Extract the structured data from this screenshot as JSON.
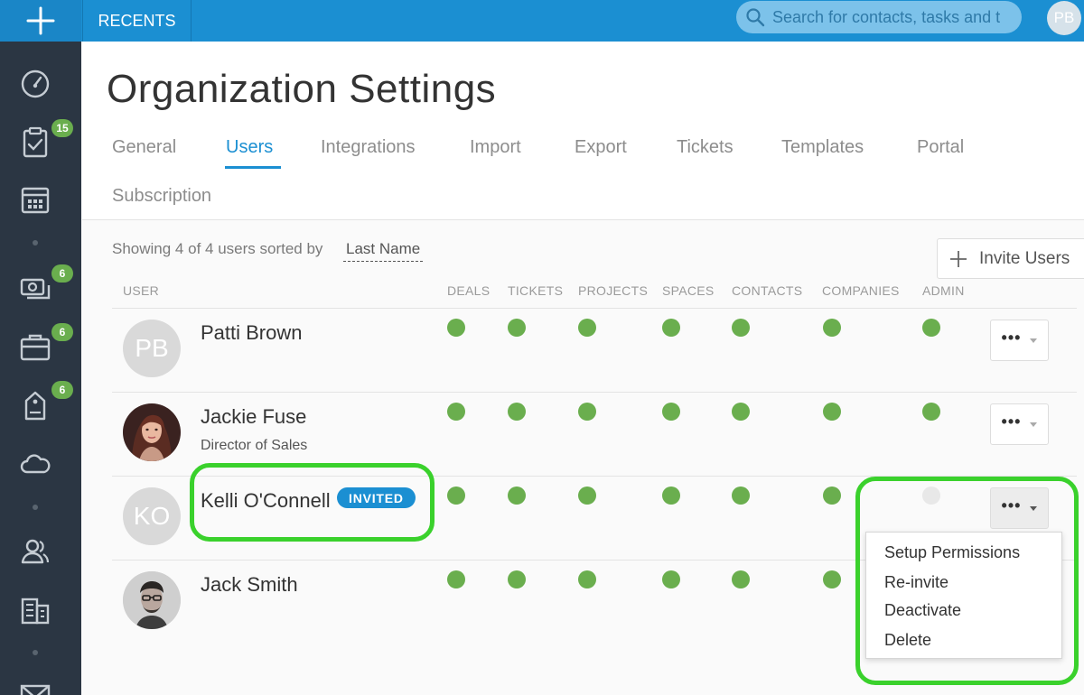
{
  "topbar": {
    "recents_label": "RECENTS",
    "search_placeholder": "Search for contacts, tasks and t",
    "user_initials": "PB"
  },
  "sidebar": {
    "items": [
      {
        "icon": "dashboard-icon"
      },
      {
        "icon": "tasks-clipboard-icon",
        "badge": "15"
      },
      {
        "icon": "calendar-icon"
      },
      {
        "icon": "money-icon",
        "badge": "6"
      },
      {
        "icon": "briefcase-icon",
        "badge": "6"
      },
      {
        "icon": "ticket-icon",
        "badge": "6"
      },
      {
        "icon": "cloud-icon"
      },
      {
        "icon": "contacts-icon"
      },
      {
        "icon": "companies-icon"
      },
      {
        "icon": "email-icon"
      }
    ]
  },
  "page": {
    "title": "Organization Settings",
    "tabs": [
      {
        "label": "General"
      },
      {
        "label": "Users",
        "active": true
      },
      {
        "label": "Integrations"
      },
      {
        "label": "Import"
      },
      {
        "label": "Export"
      },
      {
        "label": "Tickets"
      },
      {
        "label": "Templates"
      },
      {
        "label": "Portal"
      },
      {
        "label": "Subscription"
      }
    ]
  },
  "users_panel": {
    "showing_text": "Showing 4 of 4 users sorted by",
    "sort_field": "Last Name",
    "invite_label": "Invite Users",
    "columns": [
      "USER",
      "DEALS",
      "TICKETS",
      "PROJECTS",
      "SPACES",
      "CONTACTS",
      "COMPANIES",
      "ADMIN"
    ],
    "users": [
      {
        "name": "Patti Brown",
        "initials": "PB",
        "subtitle": "",
        "permissions": [
          true,
          true,
          true,
          true,
          true,
          true,
          true
        ]
      },
      {
        "name": "Jackie Fuse",
        "initials": "",
        "subtitle": "Director of Sales",
        "permissions": [
          true,
          true,
          true,
          true,
          true,
          true,
          true
        ]
      },
      {
        "name": "Kelli O'Connell",
        "initials": "KO",
        "subtitle": "",
        "badge": "INVITED",
        "permissions": [
          true,
          true,
          true,
          true,
          true,
          true,
          false
        ]
      },
      {
        "name": "Jack Smith",
        "initials": "",
        "subtitle": "",
        "permissions": [
          true,
          true,
          true,
          true,
          true,
          true,
          true
        ]
      }
    ],
    "actions_menu": [
      "Setup Permissions",
      "Re-invite",
      "Deactivate",
      "Delete"
    ]
  },
  "colors": {
    "brand_blue": "#1b8fd2",
    "sidebar_bg": "#2b3643",
    "permission_on": "#6aae4e",
    "permission_off": "#e8e8e8",
    "highlight_green": "#3ad12c"
  }
}
